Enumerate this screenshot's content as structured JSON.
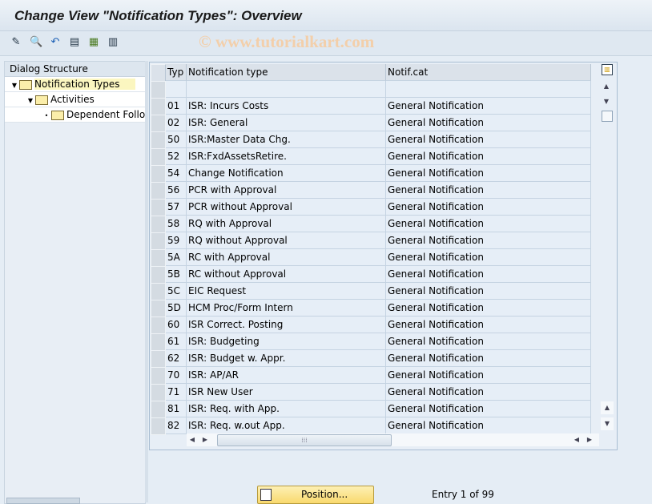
{
  "title": "Change View \"Notification Types\": Overview",
  "watermark": "© www.tutorialkart.com",
  "toolbar": [
    "edit-icon",
    "display-change-icon",
    "undo-icon",
    "select-all-icon",
    "select-block-icon",
    "deselect-all-icon"
  ],
  "dialog_structure": {
    "header": "Dialog Structure",
    "nodes": [
      {
        "label": "Notification Types",
        "level": 0,
        "selected": true
      },
      {
        "label": "Activities",
        "level": 1
      },
      {
        "label": "Dependent Follow-ups",
        "level": 2
      }
    ]
  },
  "table": {
    "columns": [
      "Typ",
      "Notification type",
      "Notif.cat"
    ],
    "rows": [
      [
        "01",
        "ISR: Incurs Costs",
        "General Notification"
      ],
      [
        "02",
        "ISR: General",
        "General Notification"
      ],
      [
        "50",
        "ISR:Master Data Chg.",
        "General Notification"
      ],
      [
        "52",
        "ISR:FxdAssetsRetire.",
        "General Notification"
      ],
      [
        "54",
        "Change Notification",
        "General Notification"
      ],
      [
        "56",
        "PCR with Approval",
        "General Notification"
      ],
      [
        "57",
        "PCR without Approval",
        "General Notification"
      ],
      [
        "58",
        "RQ with Approval",
        "General Notification"
      ],
      [
        "59",
        "RQ without Approval",
        "General Notification"
      ],
      [
        "5A",
        "RC with Approval",
        "General Notification"
      ],
      [
        "5B",
        "RC without Approval",
        "General Notification"
      ],
      [
        "5C",
        "EIC Request",
        "General Notification"
      ],
      [
        "5D",
        "HCM Proc/Form Intern",
        "General Notification"
      ],
      [
        "60",
        "ISR Correct. Posting",
        "General Notification"
      ],
      [
        "61",
        "ISR: Budgeting",
        "General Notification"
      ],
      [
        "62",
        "ISR: Budget w. Appr.",
        "General Notification"
      ],
      [
        "70",
        "ISR: AP/AR",
        "General Notification"
      ],
      [
        "71",
        "ISR New User",
        "General Notification"
      ],
      [
        "81",
        "ISR: Req. with App.",
        "General Notification"
      ],
      [
        "82",
        "ISR: Req. w.out App.",
        "General Notification"
      ]
    ]
  },
  "footer": {
    "position_label": "Position...",
    "entry_text": "Entry 1 of 99"
  }
}
